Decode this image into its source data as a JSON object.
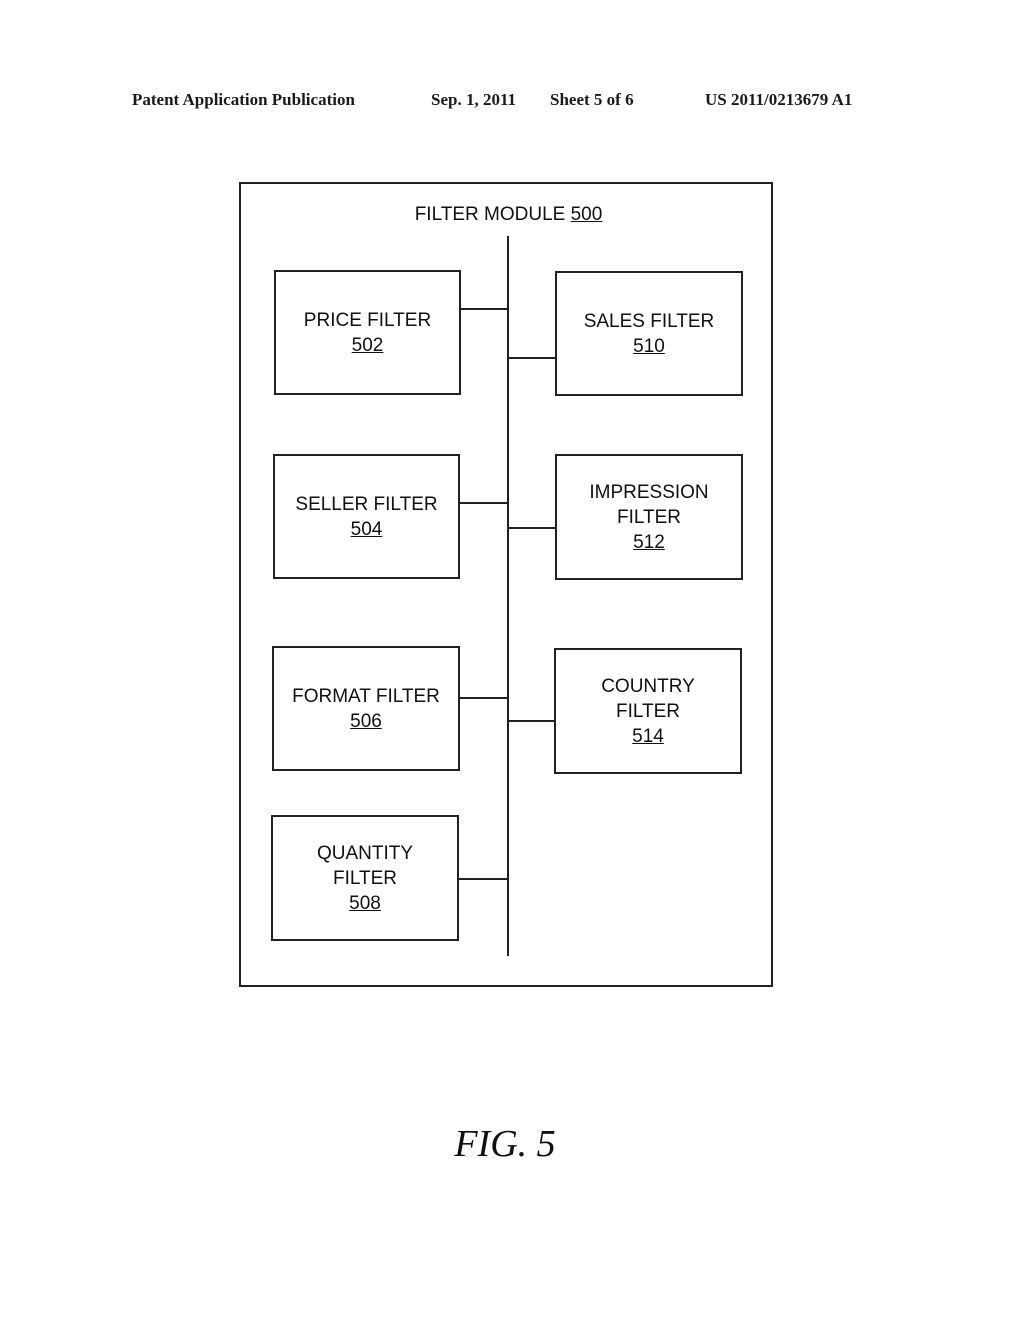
{
  "header": {
    "publication": "Patent Application Publication",
    "date": "Sep. 1, 2011",
    "sheet": "Sheet 5 of 6",
    "number": "US 2011/0213679 A1"
  },
  "diagram": {
    "title": "FILTER MODULE",
    "title_ref": "500",
    "left_column": [
      {
        "lines": [
          "PRICE FILTER"
        ],
        "ref": "502"
      },
      {
        "lines": [
          "SELLER FILTER"
        ],
        "ref": "504"
      },
      {
        "lines": [
          "FORMAT FILTER"
        ],
        "ref": "506"
      },
      {
        "lines": [
          "QUANTITY",
          "FILTER"
        ],
        "ref": "508"
      }
    ],
    "right_column": [
      {
        "lines": [
          "SALES FILTER"
        ],
        "ref": "510"
      },
      {
        "lines": [
          "IMPRESSION",
          "FILTER"
        ],
        "ref": "512"
      },
      {
        "lines": [
          "COUNTRY",
          "FILTER"
        ],
        "ref": "514"
      }
    ]
  },
  "figure_label": "FIG. 5"
}
